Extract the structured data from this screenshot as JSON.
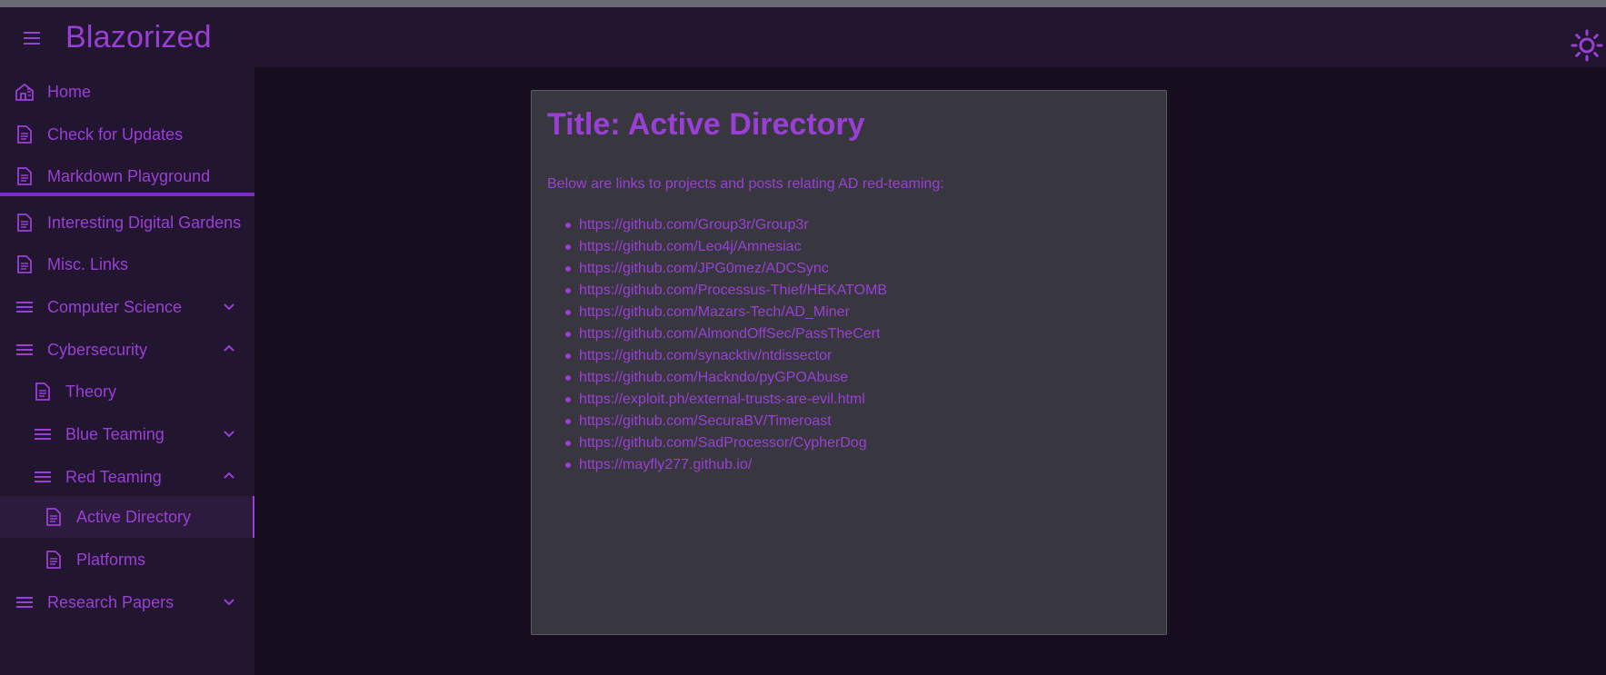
{
  "app": {
    "title": "Blazorized",
    "menu_icon": "hamburger-menu-icon",
    "theme_icon": "sun-icon"
  },
  "colors": {
    "accent": "#9a3fd6",
    "background": "#160d1f",
    "surface": "#22152f",
    "card": "#38373f"
  },
  "sidebar": {
    "items": [
      {
        "label": "Home",
        "icon": "home-icon"
      },
      {
        "label": "Check for Updates",
        "icon": "document-icon"
      },
      {
        "label": "Markdown Playground",
        "icon": "document-icon"
      },
      {
        "label": "Interesting Digital Gardens",
        "icon": "document-icon"
      },
      {
        "label": "Misc. Links",
        "icon": "document-icon"
      },
      {
        "label": "Computer Science",
        "icon": "list-icon",
        "expanded": false
      },
      {
        "label": "Cybersecurity",
        "icon": "list-icon",
        "expanded": true
      },
      {
        "label": "Theory",
        "icon": "document-icon"
      },
      {
        "label": "Blue Teaming",
        "icon": "list-icon",
        "expanded": false
      },
      {
        "label": "Red Teaming",
        "icon": "list-icon",
        "expanded": true
      },
      {
        "label": "Active Directory",
        "icon": "document-icon",
        "active": true
      },
      {
        "label": "Platforms",
        "icon": "document-icon"
      },
      {
        "label": "Research Papers",
        "icon": "list-icon",
        "expanded": false
      }
    ]
  },
  "main": {
    "title": "Title: Active Directory",
    "intro": "Below are links to projects and posts relating AD red-teaming:",
    "links": [
      "https://github.com/Group3r/Group3r",
      "https://github.com/Leo4j/Amnesiac",
      "https://github.com/JPG0mez/ADCSync",
      "https://github.com/Processus-Thief/HEKATOMB",
      "https://github.com/Mazars-Tech/AD_Miner",
      "https://github.com/AlmondOffSec/PassTheCert",
      "https://github.com/synacktiv/ntdissector",
      "https://github.com/Hackndo/pyGPOAbuse",
      "https://exploit.ph/external-trusts-are-evil.html",
      "https://github.com/SecuraBV/Timeroast",
      "https://github.com/SadProcessor/CypherDog",
      "https://mayfly277.github.io/"
    ]
  }
}
